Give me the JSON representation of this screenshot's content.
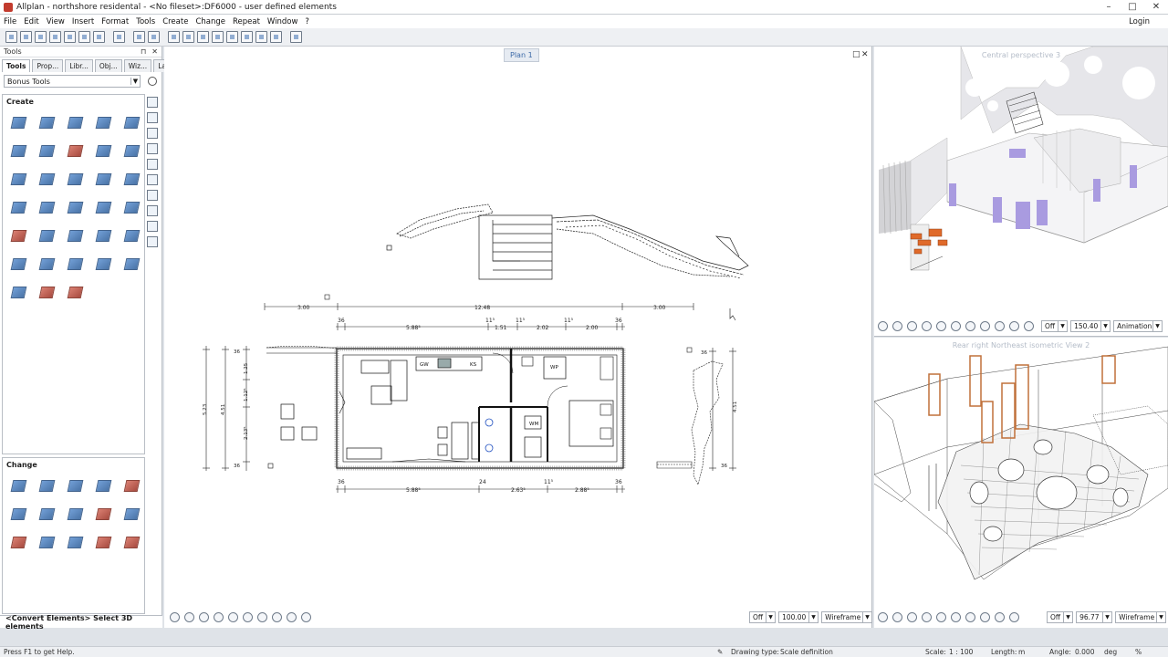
{
  "window": {
    "title": "Allplan - northshore residental - <No fileset>:DF6000 - user defined elements",
    "controls": [
      "–",
      "□",
      "✕"
    ]
  },
  "menu": {
    "items": [
      "File",
      "Edit",
      "View",
      "Insert",
      "Format",
      "Tools",
      "Create",
      "Change",
      "Repeat",
      "Window",
      "?"
    ],
    "login": "Login"
  },
  "tools_panel": {
    "header": "Tools",
    "pin": "⊓",
    "close": "✕",
    "tabs": [
      "Tools",
      "Prop...",
      "Libr...",
      "Obj...",
      "Wiz...",
      "Layers"
    ],
    "category": "Bonus Tools",
    "create_label": "Create",
    "change_label": "Change"
  },
  "plan_view": {
    "label": "Plan 1",
    "dimensions": {
      "top_overall": [
        "3.00",
        "12.48",
        "3.00"
      ],
      "top_detail": [
        "36",
        "5.88⁵",
        "11⁵",
        "1.51",
        "11⁵",
        "2.02",
        "11⁵",
        "2.00",
        "36"
      ],
      "bottom_detail": [
        "36",
        "5.88⁵",
        "24",
        "2.63⁵",
        "11⁵",
        "2.88⁵",
        "36"
      ],
      "left": [
        "5.23",
        "4.51",
        "1.25",
        "1.12⁵",
        "2.13⁵",
        "36",
        "36"
      ],
      "right": [
        "36",
        "4.51",
        "36"
      ]
    },
    "rooms": [
      "GW",
      "KS",
      "WP",
      "WM"
    ],
    "toolbar": {
      "mode": "Off",
      "scale": "100.00",
      "render": "Wireframe"
    }
  },
  "persp_view": {
    "title": "Central perspective 3",
    "toolbar": {
      "mode": "Off",
      "angle": "150.40",
      "render": "Animation"
    }
  },
  "wire_view": {
    "title": "Rear right Northeast isometric View 2",
    "toolbar": {
      "mode": "Off",
      "scale": "96.77",
      "render": "Wireframe"
    }
  },
  "command_line": "<Convert Elements> Select 3D elements",
  "status": {
    "help": "Press F1 to get Help.",
    "drawing_type_label": "Drawing type:",
    "drawing_type": "Scale definition",
    "scale_label": "Scale:",
    "scale": "1 : 100",
    "length_label": "Length:",
    "length_unit": "m",
    "angle_label": "Angle:",
    "angle": "0.000",
    "angle_unit": "deg",
    "percent": "%"
  },
  "colors": {
    "accent": "#3d6aa8",
    "tool_blue": "#2c5d99",
    "wood": "#c0703a",
    "glass": "#a99be0"
  }
}
